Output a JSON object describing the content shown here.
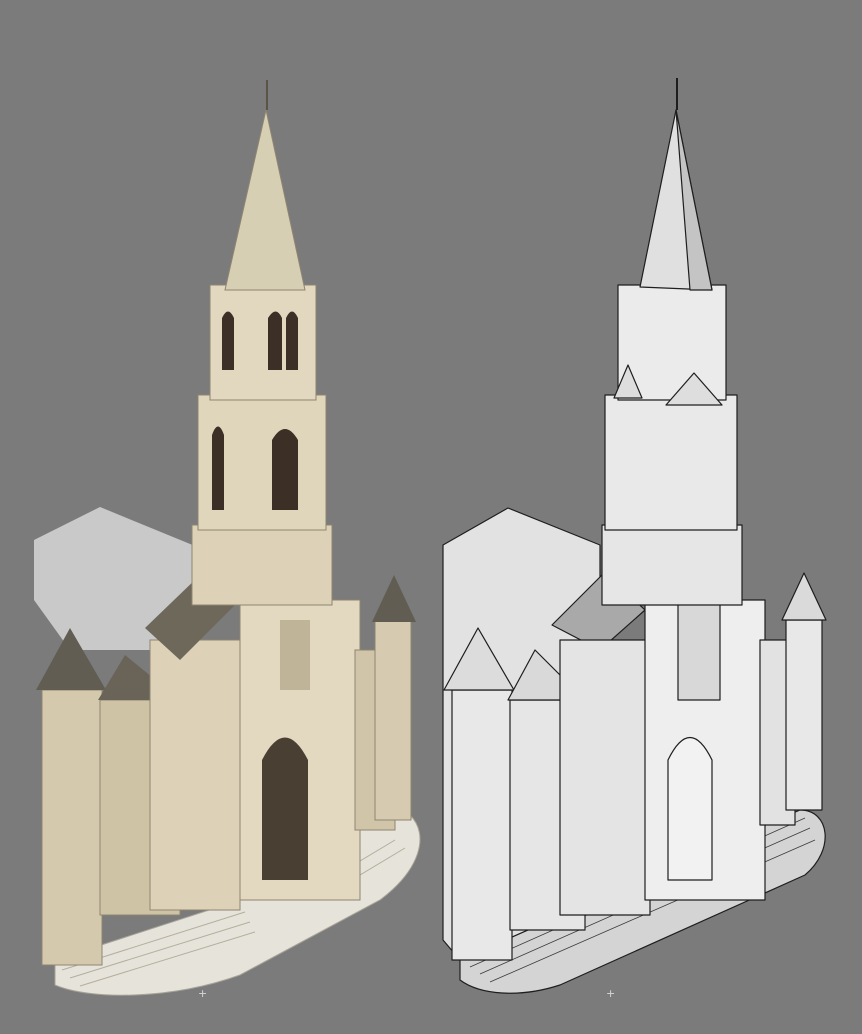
{
  "viewport": {
    "background": "#7b7b7b",
    "left_model": {
      "kind": "textured-church-model"
    },
    "right_model": {
      "kind": "untextured-church-model"
    }
  },
  "pivot_markers": {
    "left_glyph": "+",
    "right_glyph": "+"
  },
  "colors": {
    "stone": "#d9ceb4",
    "stone_shadow": "#b3a68b",
    "roof": "#6b6557",
    "clay": "#e4e4e4",
    "clay_dark": "#bdbdbd",
    "line": "#1e1e1e",
    "ground_shadow": "#c8c8c8"
  }
}
